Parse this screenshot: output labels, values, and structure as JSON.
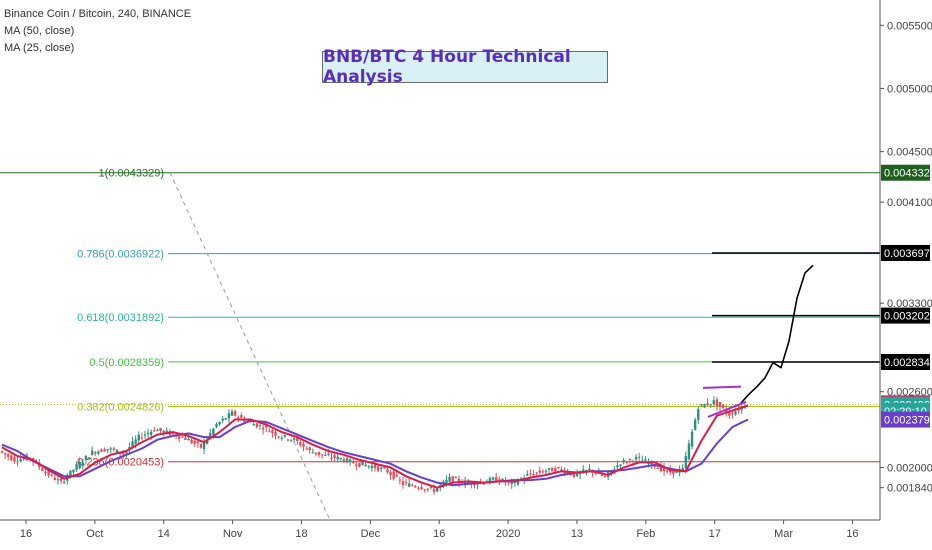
{
  "legend": {
    "symbol": "Binance Coin / Bitcoin, 240, BINANCE",
    "ma1": "MA (50, close)",
    "ma2": "MA (25, close)"
  },
  "annotation": {
    "title": "BNB/BTC 4 Hour Technical Analysis"
  },
  "colors": {
    "up": "#2f8f80",
    "down": "#e0515a",
    "ma50": "#6a3fc8",
    "ma25": "#d81e4b",
    "fib_1": "#2a6a2a",
    "fib_0786": "#3a9ec0",
    "fib_0618": "#2bb59a",
    "fib_05": "#45c43a",
    "fib_0382": "#a8c020",
    "fib_0236": "#d32f2f"
  },
  "chart_data": {
    "type": "line",
    "title": "BNB/BTC 4 Hour Technical Analysis",
    "xlabel": "",
    "ylabel": "",
    "x_ticks": [
      "16",
      "Oct",
      "14",
      "Nov",
      "18",
      "Dec",
      "16",
      "2020",
      "13",
      "Feb",
      "17",
      "Mar",
      "16"
    ],
    "y_ticks": [
      "0.0055000",
      "0.0050000",
      "0.0045000",
      "0.0041000",
      "0.0033000",
      "0.0026000",
      "0.0020000",
      "0.0018400"
    ],
    "ylim": [
      0.0016,
      0.0057
    ],
    "fib_levels": [
      {
        "label": "1(0.0043329)",
        "ratio": 1,
        "value": 0.0043329
      },
      {
        "label": "0.786(0.0036922)",
        "ratio": 0.786,
        "value": 0.0036922
      },
      {
        "label": "0.618(0.0031892)",
        "ratio": 0.618,
        "value": 0.0031892
      },
      {
        "label": "0.5(0.0028359)",
        "ratio": 0.5,
        "value": 0.0028359
      },
      {
        "label": "0.382(0.0024826)",
        "ratio": 0.382,
        "value": 0.0024826
      },
      {
        "label": "0.236(0.0020453)",
        "ratio": 0.236,
        "value": 0.0020453
      }
    ],
    "price_tags": [
      {
        "text": "0.0043329",
        "value": 0.0043329,
        "color": "#1e5e1e"
      },
      {
        "text": "0.0036977",
        "value": 0.0036977,
        "color": "#000000"
      },
      {
        "text": "0.0032021",
        "value": 0.0032021,
        "color": "#000000"
      },
      {
        "text": "0.0028348",
        "value": 0.0028348,
        "color": "#000000"
      },
      {
        "text": "0.0025071",
        "value": 0.0025071,
        "color": "#e0215a"
      },
      {
        "text": "0.0024965",
        "value": 0.0024965,
        "color": "#26a69a"
      },
      {
        "text": "02:29:10",
        "value": 0.002447,
        "color": "#26a69a"
      },
      {
        "text": "0.0023791",
        "value": 0.0023791,
        "color": "#6a3fc8"
      }
    ],
    "series": [
      {
        "name": "Binance Coin / Bitcoin",
        "values": [
          0.00213,
          0.00206,
          0.00208,
          0.00196,
          0.00188,
          0.00201,
          0.00212,
          0.00215,
          0.00211,
          0.00224,
          0.0023,
          0.00227,
          0.00223,
          0.00216,
          0.00234,
          0.00243,
          0.00236,
          0.00232,
          0.00225,
          0.00222,
          0.00213,
          0.00209,
          0.00207,
          0.00203,
          0.00201,
          0.00197,
          0.00187,
          0.00185,
          0.00182,
          0.00191,
          0.00188,
          0.00188,
          0.00191,
          0.00187,
          0.00194,
          0.00197,
          0.00199,
          0.00194,
          0.00198,
          0.00192,
          0.00204,
          0.00207,
          0.00203,
          0.00196,
          0.00198,
          0.00248,
          0.00252,
          0.00242,
          0.00249
        ]
      },
      {
        "name": "MA (50, close)",
        "values": [
          0.00218,
          0.00213,
          0.00205,
          0.00199,
          0.00193,
          0.00193,
          0.00199,
          0.00205,
          0.0021,
          0.00215,
          0.00222,
          0.00225,
          0.00227,
          0.00224,
          0.00224,
          0.00232,
          0.00237,
          0.00236,
          0.00231,
          0.00226,
          0.00221,
          0.00216,
          0.00212,
          0.00209,
          0.00206,
          0.00203,
          0.00197,
          0.00192,
          0.00188,
          0.00186,
          0.00187,
          0.00188,
          0.00189,
          0.0019,
          0.0019,
          0.00191,
          0.00194,
          0.00196,
          0.00197,
          0.00197,
          0.00198,
          0.002,
          0.00202,
          0.00199,
          0.00197,
          0.00203,
          0.00219,
          0.00232,
          0.00238
        ]
      },
      {
        "name": "MA (25, close)",
        "values": [
          0.00216,
          0.00209,
          0.00206,
          0.00198,
          0.00191,
          0.00195,
          0.00204,
          0.0021,
          0.00213,
          0.0022,
          0.00226,
          0.00228,
          0.00225,
          0.0022,
          0.00228,
          0.00238,
          0.00238,
          0.00234,
          0.00228,
          0.00224,
          0.00218,
          0.00213,
          0.0021,
          0.00206,
          0.00203,
          0.002,
          0.00193,
          0.00188,
          0.00184,
          0.00188,
          0.00189,
          0.00188,
          0.00189,
          0.00189,
          0.00192,
          0.00194,
          0.00197,
          0.00196,
          0.00197,
          0.00194,
          0.002,
          0.00204,
          0.00204,
          0.00198,
          0.00197,
          0.00221,
          0.00241,
          0.00245,
          0.00249
        ]
      }
    ],
    "projection": [
      0.00251,
      0.00258,
      0.00264,
      0.00271,
      0.00283,
      0.00279,
      0.003,
      0.00334,
      0.00354,
      0.0036
    ]
  }
}
